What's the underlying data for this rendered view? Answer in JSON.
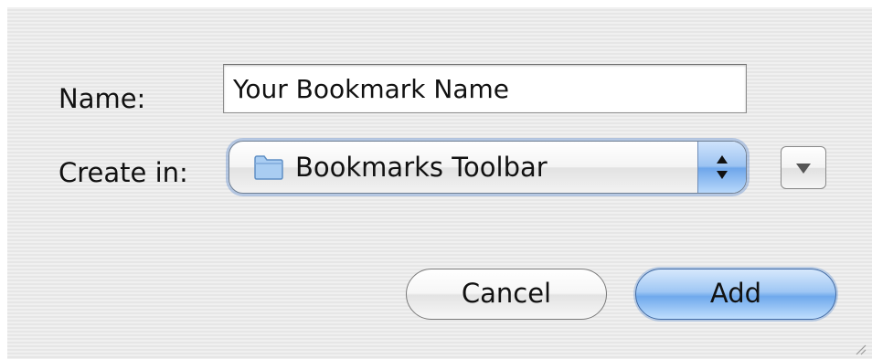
{
  "dialog": {
    "name_label": "Name:",
    "name_value": "Your Bookmark Name",
    "create_in_label": "Create in:",
    "create_in_selected": "Bookmarks Toolbar",
    "cancel_label": "Cancel",
    "add_label": "Add"
  },
  "icons": {
    "folder": "folder-icon",
    "stepper": "up-down-arrows-icon",
    "expand": "triangle-down-icon",
    "resize": "resize-grip-icon"
  },
  "colors": {
    "accent": "#6fa9ec",
    "focus_ring": "#6e96d2"
  }
}
